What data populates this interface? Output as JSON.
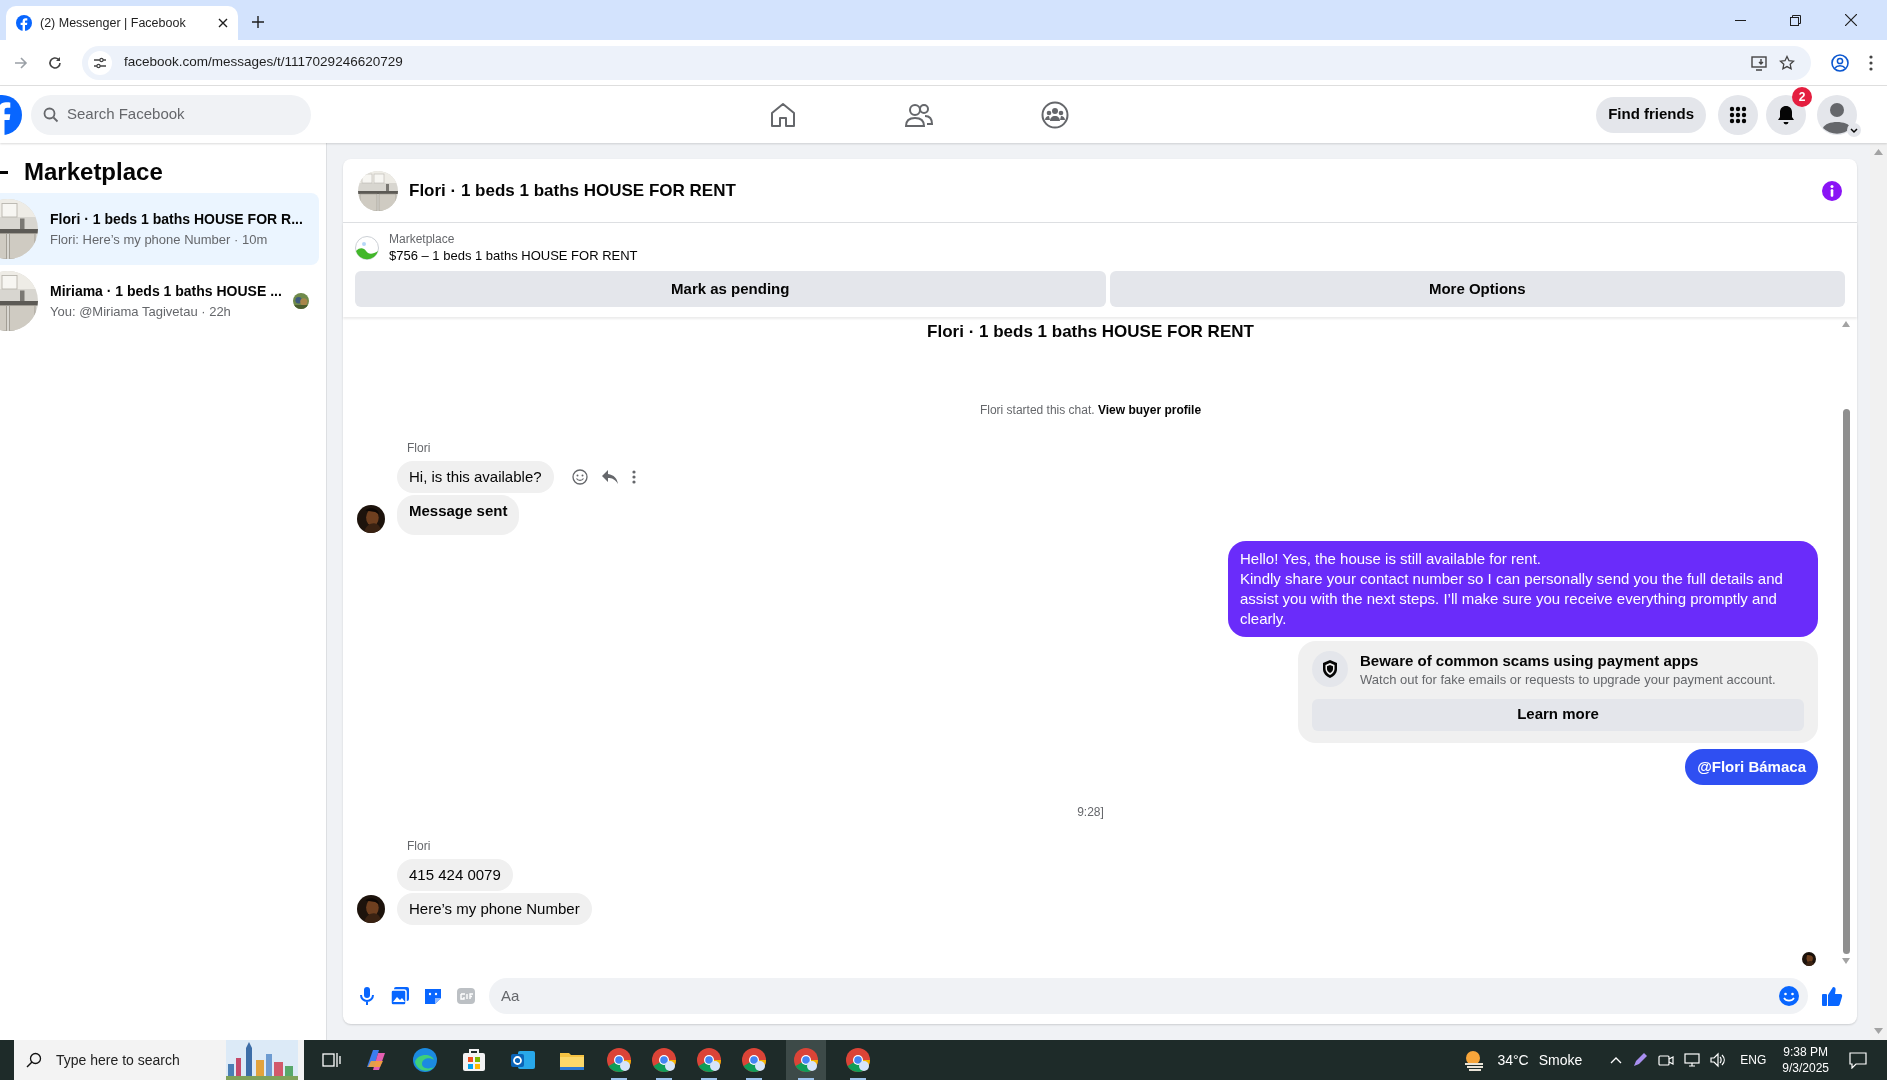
{
  "browser": {
    "tab_title": "(2) Messenger | Facebook",
    "url": "facebook.com/messages/t/1117029246620729"
  },
  "header": {
    "search_placeholder": "Search Facebook",
    "find_friends": "Find friends",
    "notification_count": "2"
  },
  "sidebar": {
    "title": "Marketplace",
    "conversations": [
      {
        "title": "Flori · 1 beds 1 baths HOUSE FOR R...",
        "preview": "Flori: Here’s my phone Number · 10m",
        "selected": true,
        "seen": false
      },
      {
        "title": "Miriama · 1 beds 1 baths HOUSE ...",
        "preview": "You: @Miriama Tagivetau · 22h",
        "selected": false,
        "seen": true
      }
    ]
  },
  "chat": {
    "title": "Flori · 1 beds 1 baths HOUSE FOR RENT",
    "listing": {
      "label": "Marketplace",
      "item": "$756 – 1 beds 1 baths HOUSE FOR RENT"
    },
    "actions": [
      "Mark as pending",
      "More Options"
    ],
    "thread_title": "Flori · 1 beds 1 baths HOUSE FOR RENT",
    "started": "Flori started this chat.",
    "profile_link": "View buyer profile",
    "messages": [
      {
        "kind": "sender",
        "text": "Flori"
      },
      {
        "kind": "incoming",
        "text": "Hi, is this available?",
        "bold": false,
        "avatar": false,
        "show_actions": true
      },
      {
        "kind": "incoming",
        "text": "Message sent",
        "bold": true,
        "avatar": true,
        "show_actions": false
      },
      {
        "kind": "outgoing",
        "text": "Hello! Yes, the house is still available for rent.\nKindly share your contact number so I can personally send you the full details and assist you with the next steps. I’ll make sure you receive everything promptly and clearly.",
        "bold": false,
        "color": "#6a2cfa"
      },
      {
        "kind": "notice",
        "title": "Beware of common scams using payment apps",
        "text": "Watch out for fake emails or requests to upgrade your payment account.",
        "button": "Learn more"
      },
      {
        "kind": "outgoing",
        "text": "@Flori Bámaca",
        "bold": true,
        "color": "#2f4ff2"
      },
      {
        "kind": "timestamp",
        "text": "9:28]"
      },
      {
        "kind": "sender",
        "text": "Flori"
      },
      {
        "kind": "incoming",
        "text": "415 424 0079",
        "bold": false,
        "avatar": false,
        "show_actions": false
      },
      {
        "kind": "incoming",
        "text": "Here’s my phone Number",
        "bold": false,
        "avatar": true,
        "show_actions": false
      }
    ],
    "composer_placeholder": "Aa"
  },
  "taskbar": {
    "search_placeholder": "Type here to search",
    "temperature": "34°C",
    "weather": "Smoke",
    "language": "ENG",
    "time": "9:38 PM",
    "date": "9/3/2025"
  }
}
